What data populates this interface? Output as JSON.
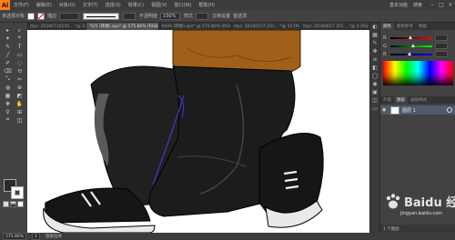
{
  "app": {
    "logo_text": "Ai"
  },
  "menu": {
    "items": [
      "文件(F)",
      "编辑(E)",
      "对象(O)",
      "文字(T)",
      "选择(S)",
      "效果(C)",
      "视图(V)",
      "窗口(W)",
      "帮助(H)"
    ]
  },
  "menubar_right": {
    "workspace_label": "基本功能",
    "search_label": "搜索"
  },
  "control_bar": {
    "selection_label": "未选择对象",
    "stroke_label": "描边",
    "stroke_value": "",
    "opacity_label": "不透明度",
    "opacity_value": "100%",
    "style_label": "样式",
    "doc_settings_label": "文档设置",
    "preferences_label": "首选项"
  },
  "doc_tabs": [
    {
      "label": "ttps: 20180710150... *@ 33 (RGB/预览)"
    },
    {
      "label": "*2/5 (转换).aps* @ 575.86% (RGB/预览)"
    },
    {
      "label": "0004 (转换).aps* @ 575.86% (RGB/预览)"
    },
    {
      "label": "ttps: 20160107 201... *@ 33 (RGB)"
    },
    {
      "label": "ttps: 20160627 201... *@ 3 (RGB)"
    }
  ],
  "tools": [
    "▸",
    "▹",
    "✦",
    "⌖",
    "✎",
    "T",
    "╱",
    "▭",
    "✐",
    "◌",
    "⌫",
    "⟲",
    "⤡",
    "✂",
    "◍",
    "⊕",
    "▦",
    "◩",
    "✥",
    "✋",
    "⚲",
    "⊞",
    "⌗",
    "◫"
  ],
  "color_panel": {
    "tabs": [
      "颜色",
      "颜色参考",
      "色板"
    ],
    "sliders": [
      {
        "label": "R",
        "value": "",
        "position": 0.47,
        "gradient": "linear-gradient(to right,#000,#f00)"
      },
      {
        "label": "G",
        "value": "",
        "position": 0.55,
        "gradient": "linear-gradient(to right,#000,#0f0)"
      },
      {
        "label": "B",
        "value": "",
        "position": 0.45,
        "gradient": "linear-gradient(to right,#000,#00f)"
      }
    ]
  },
  "layers_panel": {
    "tabs": [
      "外观",
      "图层",
      "画板样式"
    ],
    "layer_name": "图层 1",
    "footer_text": "1 个图层"
  },
  "status": {
    "zoom": "575.86%",
    "page": "1",
    "tool_name": "直接选择"
  },
  "watermark": {
    "text": "Baidu 经验",
    "url": "jingyan.baidu.com"
  },
  "colors": {
    "brand": "#ff7f18",
    "pants": "#1f1f1f",
    "jacket": "#a0601a",
    "highlight": "#5a5a5a",
    "shoe": "#161616",
    "sole": "#e9e9e9",
    "selection": "#3b3bc9"
  }
}
